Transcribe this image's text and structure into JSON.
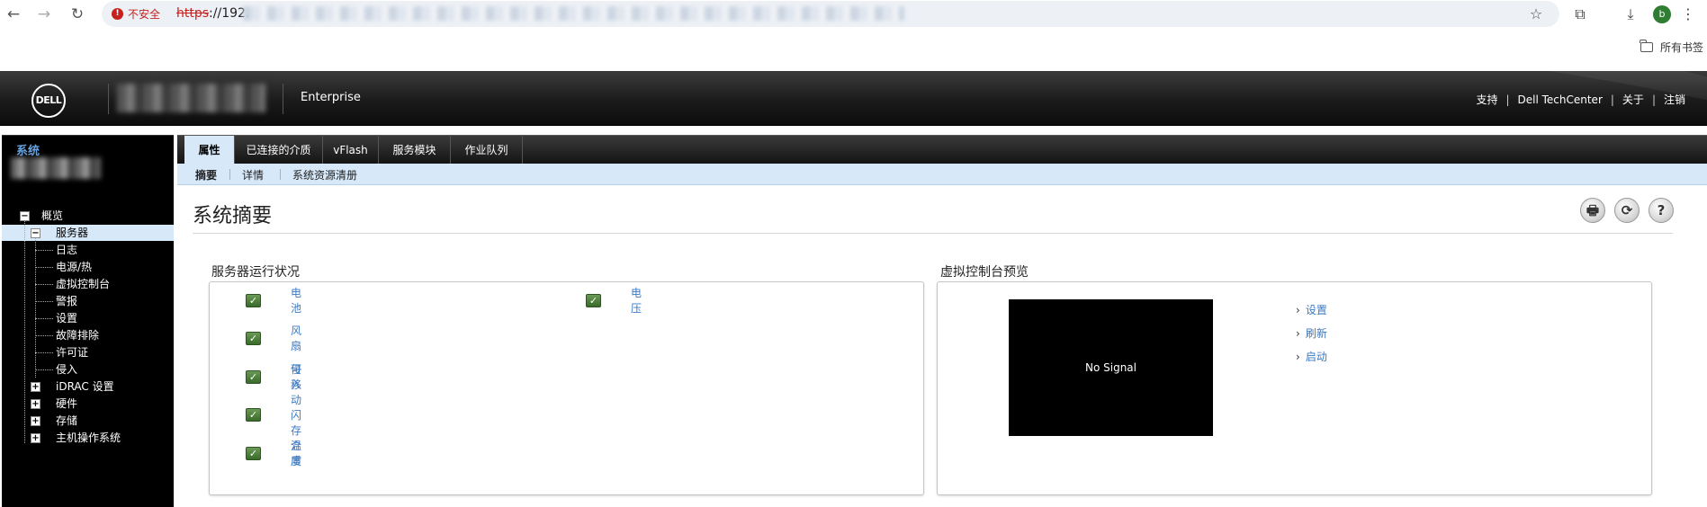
{
  "browser": {
    "security_label": "不安全",
    "url_scheme": "https",
    "url_visible": "://192.",
    "bookmarks_label": "所有书签",
    "profile_initial": "b"
  },
  "header": {
    "edition": "Enterprise",
    "links": [
      "支持",
      "Dell TechCenter",
      "关于",
      "注销"
    ]
  },
  "sidebar": {
    "title": "系统",
    "tree": [
      {
        "label": "概览",
        "level": 0,
        "toggle": "−"
      },
      {
        "label": "服务器",
        "level": 1,
        "toggle": "−",
        "selected": true
      },
      {
        "label": "日志",
        "level": 2
      },
      {
        "label": "电源/热",
        "level": 2
      },
      {
        "label": "虚拟控制台",
        "level": 2
      },
      {
        "label": "警报",
        "level": 2
      },
      {
        "label": "设置",
        "level": 2
      },
      {
        "label": "故障排除",
        "level": 2
      },
      {
        "label": "许可证",
        "level": 2
      },
      {
        "label": "侵入",
        "level": 2
      },
      {
        "label": "iDRAC 设置",
        "level": 1,
        "toggle": "+"
      },
      {
        "label": "硬件",
        "level": 1,
        "toggle": "+"
      },
      {
        "label": "存储",
        "level": 1,
        "toggle": "+"
      },
      {
        "label": "主机操作系统",
        "level": 1,
        "toggle": "+"
      }
    ]
  },
  "tabs": [
    "属性",
    "已连接的介质",
    "vFlash",
    "服务模块",
    "作业队列"
  ],
  "active_tab": "属性",
  "subtabs": [
    "摘要",
    "详情",
    "系统资源清册"
  ],
  "active_subtab": "摘要",
  "page": {
    "title": "系统摘要",
    "actions": [
      {
        "name": "print",
        "glyph": "🖶"
      },
      {
        "name": "refresh",
        "glyph": "⟳"
      },
      {
        "name": "help",
        "glyph": "?"
      }
    ]
  },
  "health": {
    "title": "服务器运行状况",
    "items": [
      {
        "label": "电池",
        "status": "ok"
      },
      {
        "label": "电压",
        "status": "ok"
      },
      {
        "label": "风扇",
        "status": "ok"
      },
      {
        "label": "侵入",
        "status": "ok"
      },
      {
        "label": "可移动闪存介质",
        "status": "ok"
      },
      {
        "label": "温度",
        "status": "ok"
      }
    ]
  },
  "console": {
    "title": "虚拟控制台预览",
    "screen_text": "No Signal",
    "links": [
      "设置",
      "刷新",
      "启动"
    ]
  },
  "colors": {
    "accent_blue": "#3d79c2",
    "selected_bg": "#d7e8f8",
    "ok_green": "#4a7a3a",
    "insecure_red": "#c5221f"
  }
}
